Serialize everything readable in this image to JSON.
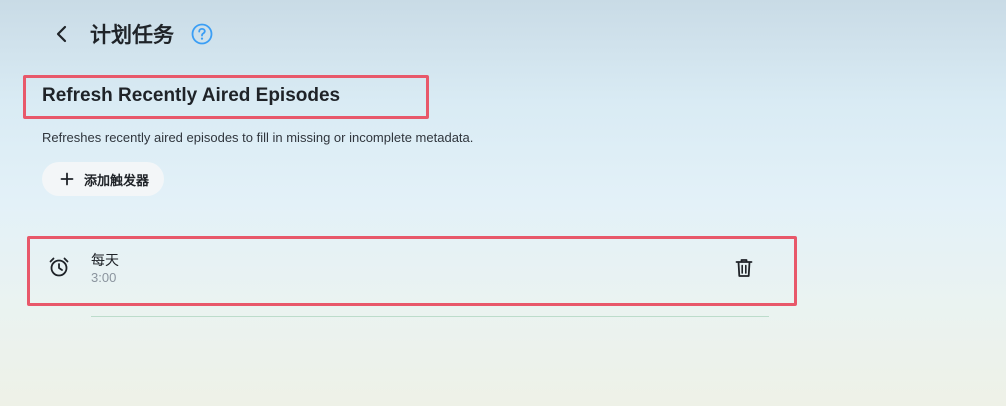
{
  "header": {
    "title": "计划任务",
    "back_icon": "chevron-left-icon",
    "help_icon": "question-circle-icon"
  },
  "task": {
    "title": "Refresh Recently Aired Episodes",
    "description": "Refreshes recently aired episodes to fill in missing or incomplete metadata."
  },
  "add_trigger": {
    "label": "添加触发器",
    "icon": "plus-icon"
  },
  "triggers": [
    {
      "name": "每天",
      "time": "3:00",
      "icon": "alarm-clock-icon",
      "delete_icon": "trash-icon"
    }
  ],
  "colors": {
    "highlight_border": "#e8586a",
    "help_icon": "#3b9ef5",
    "divider": "#bcdccb",
    "secondary_text": "#8b949e"
  }
}
